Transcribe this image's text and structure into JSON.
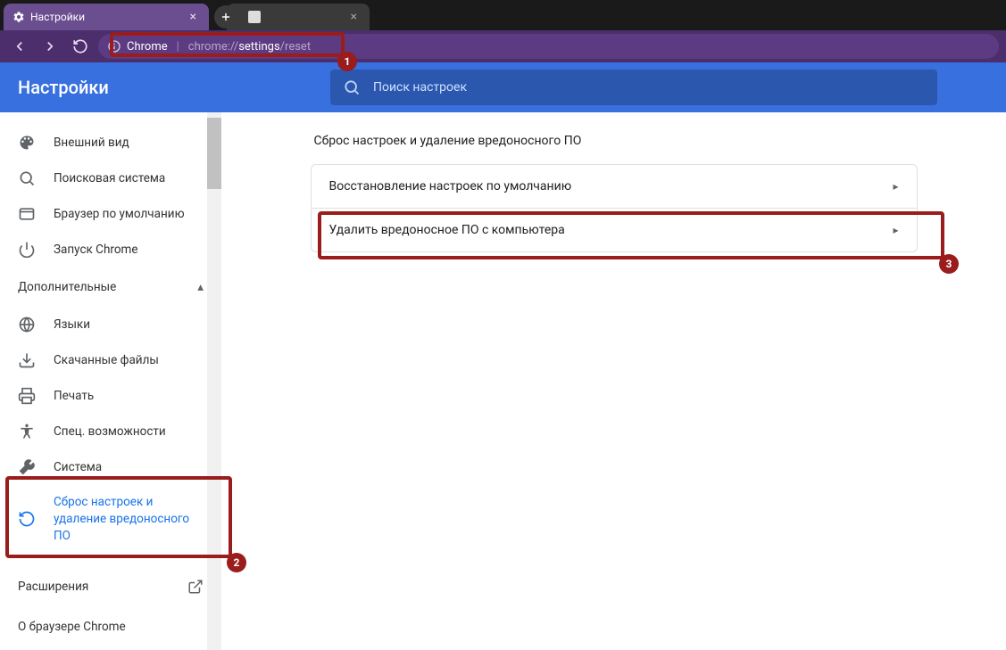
{
  "tabs": {
    "active": {
      "title": "Настройки"
    },
    "inactive": {
      "title": ""
    }
  },
  "omnibox": {
    "origin": "Chrome",
    "url_prefix": "chrome://",
    "url_bold": "settings",
    "url_suffix": "/reset"
  },
  "header": {
    "title": "Настройки",
    "search_placeholder": "Поиск настроек"
  },
  "sidebar": {
    "items_basic": [
      {
        "id": "appearance",
        "label": "Внешний вид"
      },
      {
        "id": "search-engine",
        "label": "Поисковая система"
      },
      {
        "id": "default-browser",
        "label": "Браузер по умолчанию"
      },
      {
        "id": "on-startup",
        "label": "Запуск Chrome"
      }
    ],
    "advanced_label": "Дополнительные",
    "items_advanced": [
      {
        "id": "languages",
        "label": "Языки"
      },
      {
        "id": "downloads",
        "label": "Скачанные файлы"
      },
      {
        "id": "printing",
        "label": "Печать"
      },
      {
        "id": "accessibility",
        "label": "Спец. возможности"
      },
      {
        "id": "system",
        "label": "Система"
      },
      {
        "id": "reset",
        "label": "Сброс настроек и удаление вредоносного ПО"
      }
    ],
    "extensions": "Расширения",
    "about": "О браузере Chrome"
  },
  "content": {
    "section_title": "Сброс настроек и удаление вредоносного ПО",
    "rows": [
      {
        "label": "Восстановление настроек по умолчанию"
      },
      {
        "label": "Удалить вредоносное ПО с компьютера"
      }
    ]
  },
  "annotations": {
    "a1": "1",
    "a2": "2",
    "a3": "3"
  }
}
